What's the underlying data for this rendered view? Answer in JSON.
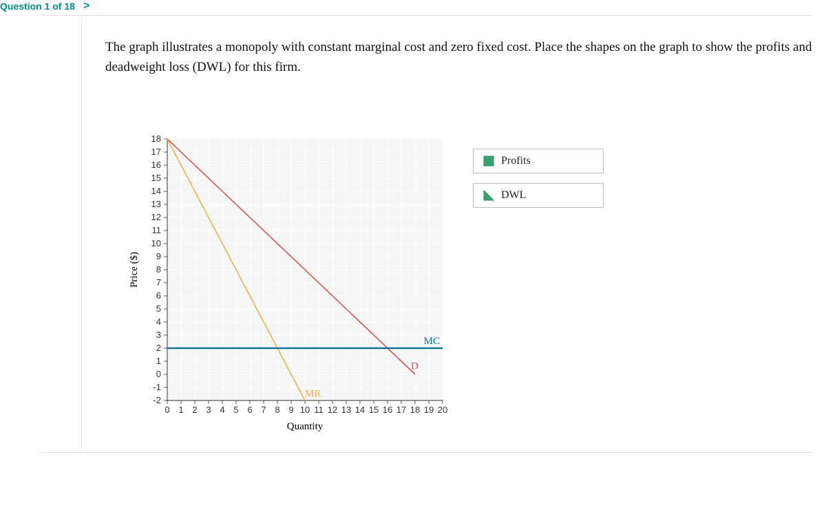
{
  "header": {
    "question_label": "Question 1 of 18",
    "chevron": ">"
  },
  "prompt": "The graph illustrates a monopoly with constant marginal cost and zero fixed cost. Place the shapes on the graph to show the profits and deadweight loss (DWL) for this firm.",
  "legend": {
    "profits": "Profits",
    "dwl": "DWL"
  },
  "chart_data": {
    "type": "line",
    "xlabel": "Quantity",
    "ylabel": "Price ($)",
    "xlim": [
      0,
      20
    ],
    "ylim": [
      -2,
      18
    ],
    "x_ticks": [
      0,
      1,
      2,
      3,
      4,
      5,
      6,
      7,
      8,
      9,
      10,
      11,
      12,
      13,
      14,
      15,
      16,
      17,
      18,
      19,
      20
    ],
    "y_ticks": [
      -2,
      -1,
      0,
      1,
      2,
      3,
      4,
      5,
      6,
      7,
      8,
      9,
      10,
      11,
      12,
      13,
      14,
      15,
      16,
      17,
      18
    ],
    "series": [
      {
        "name": "D",
        "color": "#d9534f",
        "points": [
          [
            0,
            18
          ],
          [
            18,
            0
          ]
        ]
      },
      {
        "name": "MR",
        "color": "#f0ad4e",
        "points": [
          [
            0,
            18
          ],
          [
            10,
            -2
          ]
        ]
      },
      {
        "name": "MC",
        "color": "#006b8f",
        "points": [
          [
            0,
            2
          ],
          [
            20,
            2
          ]
        ]
      }
    ],
    "curve_labels": {
      "D": "D",
      "MR": "MR",
      "MC": "MC"
    },
    "grid": true
  }
}
